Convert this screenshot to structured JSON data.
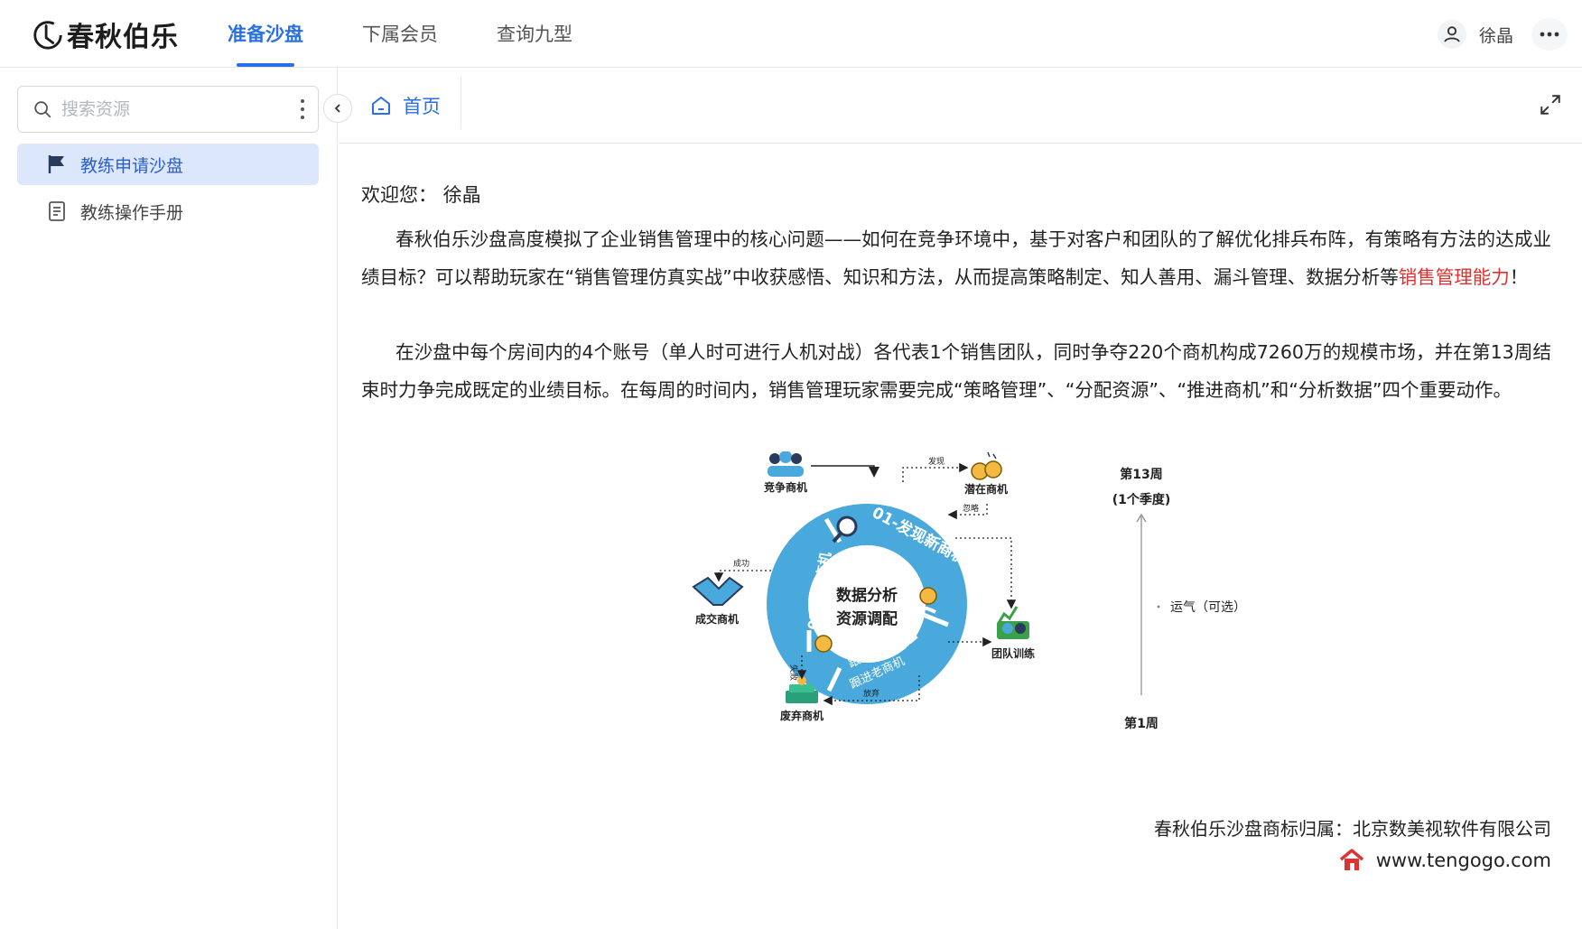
{
  "app": {
    "logo_text": "春秋伯乐"
  },
  "nav": {
    "tabs": [
      {
        "label": "准备沙盘",
        "active": true
      },
      {
        "label": "下属会员",
        "active": false
      },
      {
        "label": "查询九型",
        "active": false
      }
    ],
    "user_name": "徐晶",
    "more_icon": "ellipsis-icon"
  },
  "sidebar": {
    "search_placeholder": "搜索资源",
    "items": [
      {
        "label": "教练申请沙盘",
        "icon": "flag-icon",
        "active": true
      },
      {
        "label": "教练操作手册",
        "icon": "document-icon",
        "active": false
      }
    ]
  },
  "tabstrip": {
    "home_label": "首页"
  },
  "content": {
    "welcome": "欢迎您：  徐晶",
    "para1_a": "春秋伯乐沙盘高度模拟了企业销售管理中的核心问题——如何在竞争环境中，基于对客户和团队的了解优化排兵布阵，有策略有方法的达成业绩目标？可以帮助玩家在“销售管理仿真实战”中收获感悟、知识和方法，从而提高策略制定、知人善用、漏斗管理、数据分析等",
    "para1_highlight": "销售管理能力",
    "para1_end": "！",
    "para2": "在沙盘中每个房间内的4个账号（单人时可进行人机对战）各代表1个销售团队，同时争夺220个商机构成7260万的规模市场，并在第13周结束时力争完成既定的业绩目标。在每周的时间内，销售管理玩家需要完成“策略管理”、“分配资源”、“推进商机”和“分析数据”四个重要动作。",
    "highlight_color": "#e03131"
  },
  "diagram": {
    "center_line1": "数据分析",
    "center_line2": "资源调配",
    "seg1": "01-发现新商机",
    "seg2_a": "跟进新商机",
    "seg2_b": "跟进老商机",
    "seg2_num": "02",
    "seg3": "03-推进商机",
    "node_compete": "竞争商机",
    "node_potential": "潜在商机",
    "node_deal": "成交商机",
    "node_team": "团队训练",
    "node_abandon": "废弃商机",
    "edge_discover": "发现",
    "edge_ignore": "忽略",
    "edge_success": "成功",
    "edge_fail": "失败",
    "edge_giveup": "放弃",
    "week_top": "第13周",
    "week_top_sub": "(1个季度)",
    "luck": "运气（可选）",
    "week_bottom": "第1周",
    "ring_color": "#4aa9dc"
  },
  "footer": {
    "trademark": "春秋伯乐沙盘商标归属：北京数美视软件有限公司",
    "url": "www.tengogo.com"
  }
}
